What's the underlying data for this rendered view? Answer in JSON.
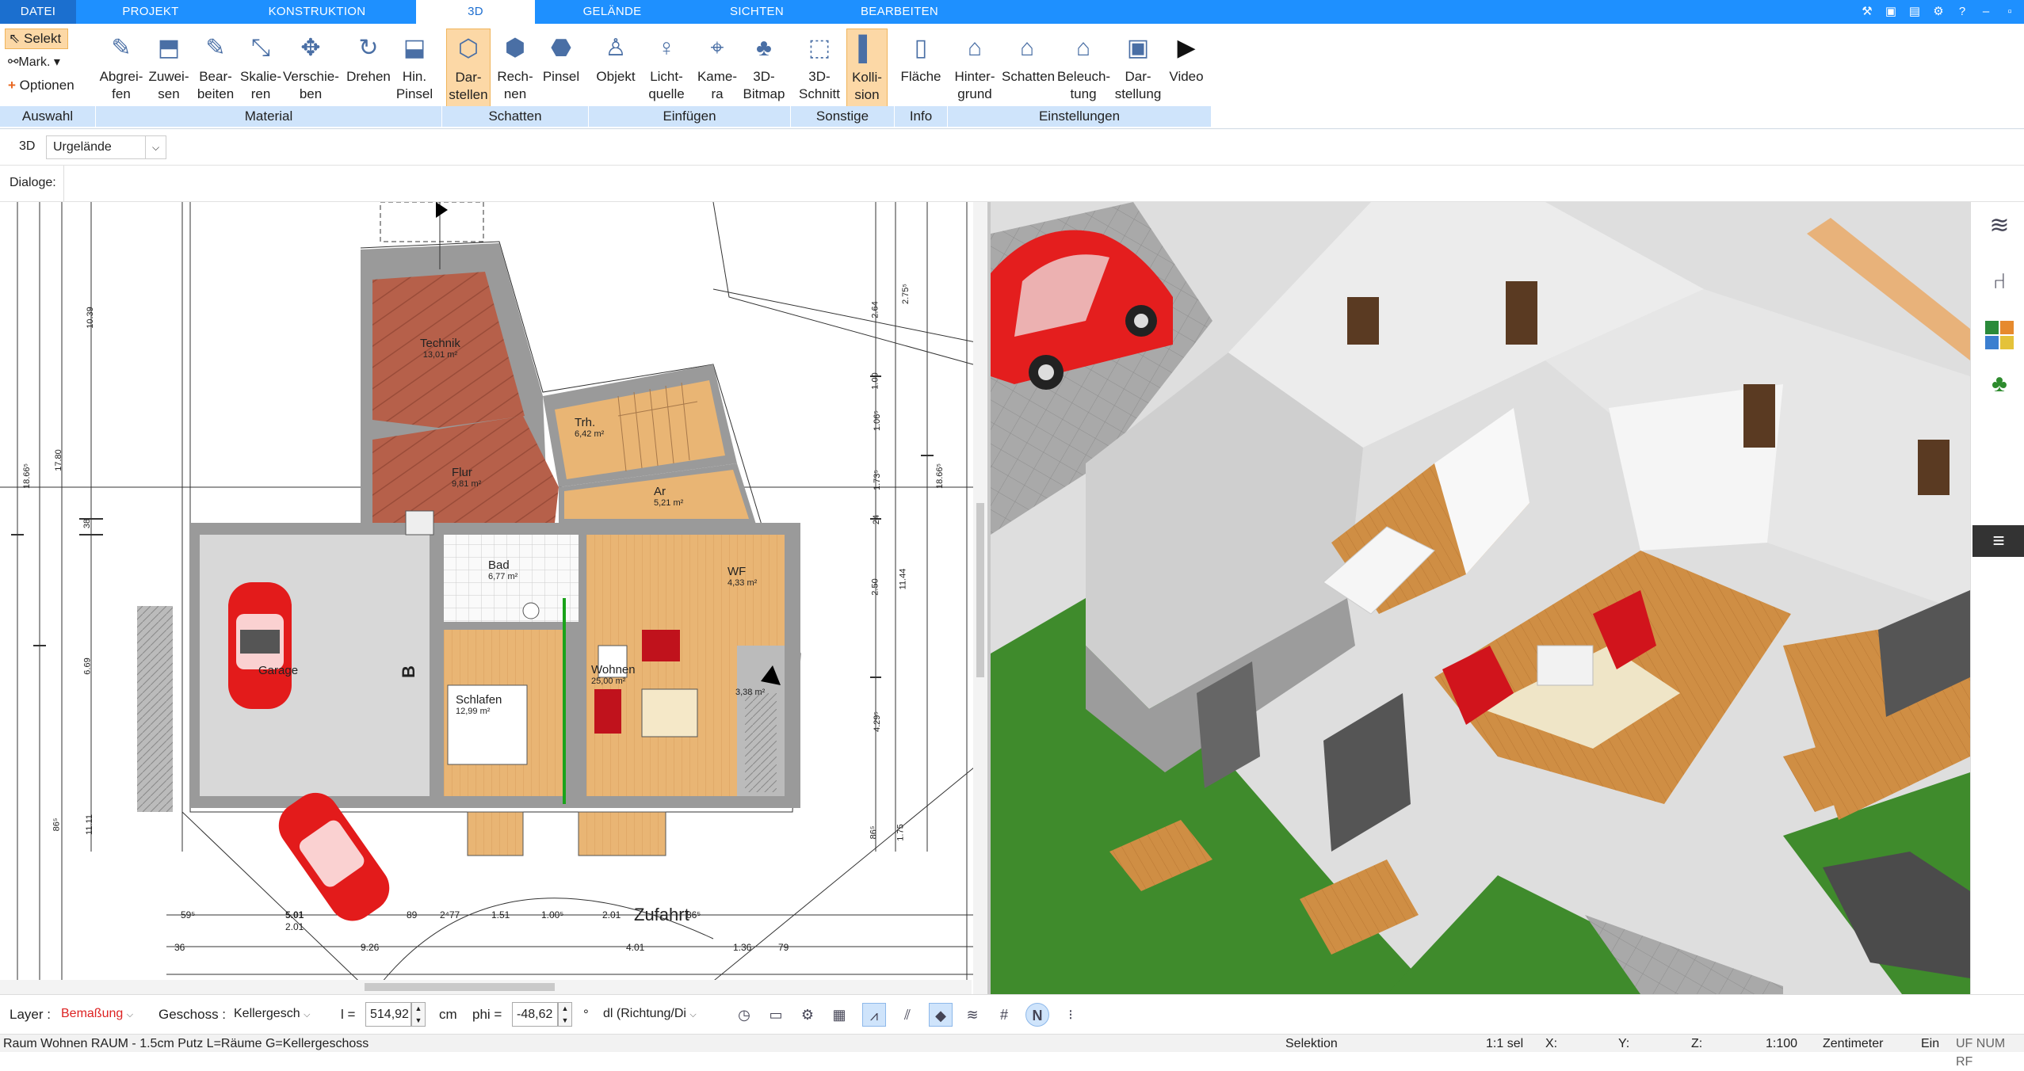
{
  "tabs": [
    "DATEI",
    "PROJEKT",
    "KONSTRUKTION",
    "3D",
    "GELÄNDE",
    "SICHTEN",
    "BEARBEITEN"
  ],
  "ribbon": {
    "auswahl": {
      "selekt": "Selekt",
      "mark": "Mark.",
      "optionen": "Optionen"
    },
    "buttons": [
      {
        "label": "Abgrei-\nfen"
      },
      {
        "label": "Zuwei-\nsen"
      },
      {
        "label": "Bear-\nbeiten"
      },
      {
        "label": "Skalie-\nren"
      },
      {
        "label": "Verschie-\nben"
      },
      {
        "label": "Drehen"
      },
      {
        "label": "Hin.\nPinsel"
      },
      {
        "label": "Dar-\nstellen"
      },
      {
        "label": "Rech-\nnen"
      },
      {
        "label": "Pinsel"
      },
      {
        "label": "Objekt"
      },
      {
        "label": "Licht-\nquelle"
      },
      {
        "label": "Kame-\nra"
      },
      {
        "label": "3D-\nBitmap"
      },
      {
        "label": "3D-\nSchnitt"
      },
      {
        "label": "Kolli-\nsion"
      },
      {
        "label": "Fläche"
      },
      {
        "label": "Hinter-\ngrund"
      },
      {
        "label": "Schatten"
      },
      {
        "label": "Beleuch-\ntung"
      },
      {
        "label": "Dar-\nstellung"
      },
      {
        "label": "Video"
      }
    ],
    "groups": [
      "Auswahl",
      "Material",
      "Schatten",
      "Einfügen",
      "Sonstige",
      "Info",
      "Einstellungen"
    ]
  },
  "row2": {
    "view": "3D",
    "layer_select": "Urgelände"
  },
  "row3": {
    "label": "Dialoge:"
  },
  "plan": {
    "rooms": [
      {
        "name": "Technik",
        "area": "13,01 m²"
      },
      {
        "name": "Trh.",
        "area": "6,42 m²"
      },
      {
        "name": "Flur",
        "area": "9,81 m²"
      },
      {
        "name": "Ar",
        "area": "5,21 m²"
      },
      {
        "name": "Bad",
        "area": "6,77 m²"
      },
      {
        "name": "WF",
        "area": "4,33 m²"
      },
      {
        "name": "Garage",
        "area": ""
      },
      {
        "name": "Wohnen",
        "area": "25,00 m²"
      },
      {
        "name": "Schlafen",
        "area": "12,99 m²"
      },
      {
        "name": "",
        "area": "3,38 m²"
      }
    ],
    "label_zufahrt": "Zufahrt",
    "section_mark": "B",
    "dims_left": [
      "10.39",
      "17.80",
      "18.66⁵",
      "6.69",
      "11.11",
      "86⁵",
      "38"
    ],
    "dims_right": [
      "2.75⁵",
      "2.64",
      "1.00",
      "1.06⁵",
      "1.73⁵",
      "24",
      "2.50",
      "11.44",
      "4.29⁵",
      "1.75",
      "86⁵",
      "18.66⁵"
    ],
    "dims_bottom_row1": [
      "59⁵",
      "5.01",
      "89",
      "2⁴77",
      "1.51",
      "1.00⁵",
      "2.01",
      "86⁵"
    ],
    "dims_bottom_row2": [
      "2.01",
      "9.26"
    ],
    "dims_bottom_row3": [
      "36",
      "4.01",
      "1.36",
      "79"
    ]
  },
  "bottom": {
    "layer_label": "Layer :",
    "layer_value": "Bemaßung",
    "geschoss_label": "Geschoss :",
    "geschoss_value": "Kellergesch",
    "l_label": "l =",
    "l_value": "514,92",
    "l_unit": "cm",
    "phi_label": "phi =",
    "phi_value": "-48,62",
    "phi_unit": "°",
    "dl_value": "dl (Richtung/Di"
  },
  "status": {
    "message": "Raum Wohnen RAUM - 1.5cm Putz L=Räume G=Kellergeschoss",
    "mode": "Selektion",
    "sel": "1:1 sel",
    "x": "X:",
    "y": "Y:",
    "z": "Z:",
    "scale": "1:100",
    "unit": "Zentimeter",
    "ein": "Ein",
    "flags": "UF NUM RF"
  },
  "colors": {
    "accent": "#1e90ff",
    "ribbon_group": "#cfe4fb",
    "selected": "#fcd8a6",
    "wall": "#9a9a9a",
    "parquet": "#e8b474",
    "brick": "#b6604a",
    "grass": "#3f8b2c"
  }
}
